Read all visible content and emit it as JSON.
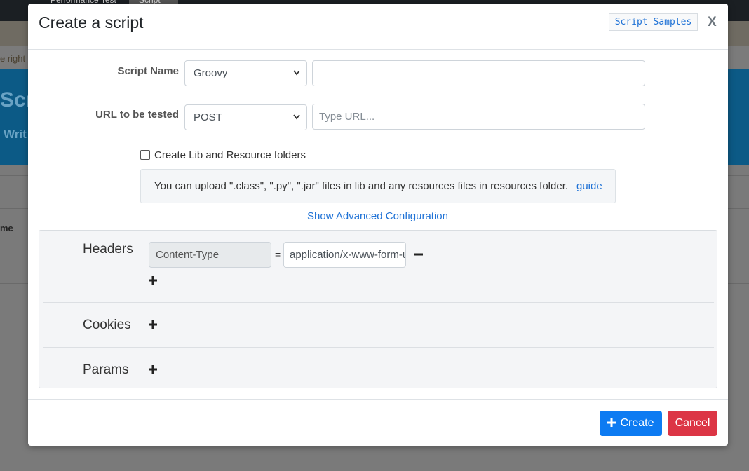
{
  "background": {
    "tabs": [
      "Performance Test",
      "Script"
    ],
    "partial_text": "e right",
    "banner_title": "Scr",
    "banner_subtitle": "Writ",
    "column_header": "me"
  },
  "modal": {
    "title": "Create a script",
    "samples_label": "Script Samples",
    "close_label": "X",
    "script_name": {
      "label": "Script Name",
      "language_selected": "Groovy",
      "name_value": ""
    },
    "url": {
      "label": "URL to be tested",
      "method_selected": "POST",
      "url_placeholder": "Type URL..."
    },
    "lib_checkbox": {
      "label": "Create Lib and Resource folders",
      "checked": false
    },
    "info": {
      "text": "You can upload \".class\", \".py\", \".jar\" files in lib and any resources files in resources folder.",
      "link": "guide"
    },
    "advanced_link": "Show Advanced Configuration",
    "advanced": {
      "headers_label": "Headers",
      "header_key": "Content-Type",
      "header_eq": "=",
      "header_value": "application/x-www-form-urlencoded",
      "cookies_label": "Cookies",
      "params_label": "Params"
    },
    "footer": {
      "create_label": "Create",
      "cancel_label": "Cancel"
    }
  },
  "colors": {
    "primary": "#0d7bf2",
    "danger": "#dc3545",
    "link": "#1f72d6"
  }
}
